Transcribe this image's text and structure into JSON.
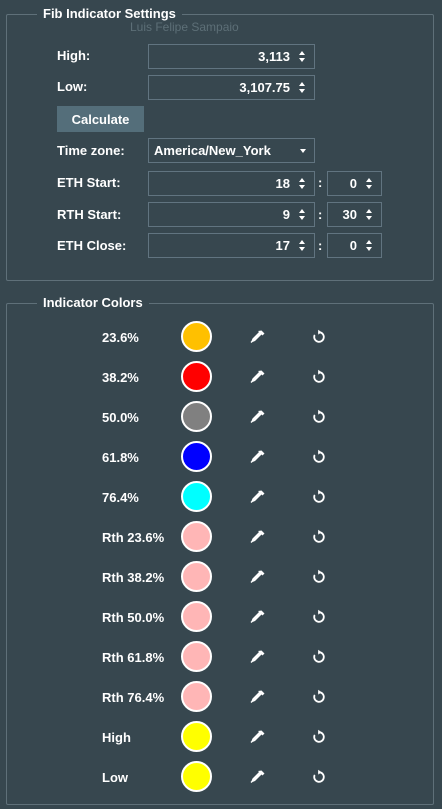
{
  "settings": {
    "title": "Fib Indicator Settings",
    "watermark": "Luis Felipe Sampaio",
    "high_label": "High:",
    "high_value": "3,113",
    "low_label": "Low:",
    "low_value": "3,107.75",
    "calculate_label": "Calculate",
    "timezone_label": "Time zone:",
    "timezone_value": "America/New_York",
    "eth_start_label": "ETH Start:",
    "eth_start_hour": "18",
    "eth_start_min": "0",
    "rth_start_label": "RTH Start:",
    "rth_start_hour": "9",
    "rth_start_min": "30",
    "eth_close_label": "ETH Close:",
    "eth_close_hour": "17",
    "eth_close_min": "0",
    "colon": ":"
  },
  "colors": {
    "title": "Indicator Colors",
    "items": [
      {
        "label": "23.6%",
        "color": "#ffc000"
      },
      {
        "label": "38.2%",
        "color": "#ff0000"
      },
      {
        "label": "50.0%",
        "color": "#808080"
      },
      {
        "label": "61.8%",
        "color": "#0000ff"
      },
      {
        "label": "76.4%",
        "color": "#00ffff"
      },
      {
        "label": "Rth 23.6%",
        "color": "#ffb6b6"
      },
      {
        "label": "Rth 38.2%",
        "color": "#ffb6b6"
      },
      {
        "label": "Rth 50.0%",
        "color": "#ffb6b6"
      },
      {
        "label": "Rth 61.8%",
        "color": "#ffb6b6"
      },
      {
        "label": "Rth 76.4%",
        "color": "#ffb6b6"
      },
      {
        "label": "High",
        "color": "#ffff00"
      },
      {
        "label": "Low",
        "color": "#ffff00"
      }
    ],
    "picker_icon": "eyedropper-icon",
    "reset_icon": "reset-icon"
  }
}
